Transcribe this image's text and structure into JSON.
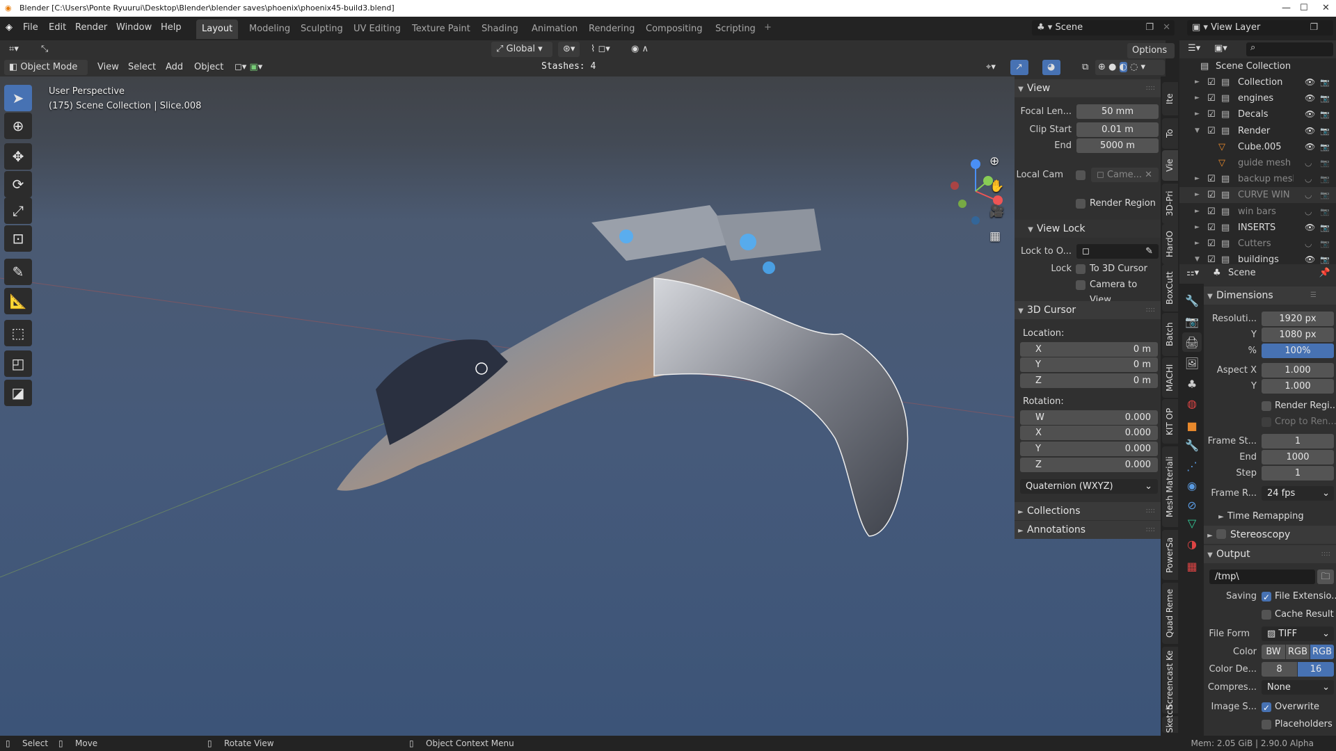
{
  "window": {
    "title": "Blender [C:\\Users\\Ponte Ryuurui\\Desktop\\Blender\\blender saves\\phoenix\\phoenix45-build3.blend]"
  },
  "menu": [
    "File",
    "Edit",
    "Render",
    "Window",
    "Help"
  ],
  "workspaces": [
    {
      "label": "Layout",
      "active": true
    },
    {
      "label": "Modeling"
    },
    {
      "label": "Sculpting"
    },
    {
      "label": "UV Editing"
    },
    {
      "label": "Texture Paint"
    },
    {
      "label": "Shading"
    },
    {
      "label": "Animation"
    },
    {
      "label": "Rendering"
    },
    {
      "label": "Compositing"
    },
    {
      "label": "Scripting"
    }
  ],
  "add_workspace": "+",
  "scene_selector": {
    "value": "Scene"
  },
  "view_layer_selector": {
    "value": "View Layer"
  },
  "tool_settings": {
    "orientation": "Global",
    "options": "Options"
  },
  "viewport_header": {
    "mode": "Object Mode",
    "menus": [
      "View",
      "Select",
      "Add",
      "Object"
    ],
    "stashes": "Stashes: 4"
  },
  "viewport_overlay": {
    "line1": "User Perspective",
    "line2": "(175) Scene Collection | Slice.008"
  },
  "toolbar": [
    "select-box",
    "cursor",
    "move",
    "rotate",
    "scale",
    "transform",
    "annotate",
    "measure",
    "add-cube",
    "extrude-region",
    "bevel"
  ],
  "npanel": {
    "view": {
      "title": "View",
      "focal_label": "Focal Len...",
      "focal": "50 mm",
      "clip_start_label": "Clip Start",
      "clip_start": "0.01 m",
      "end_label": "End",
      "end": "5000 m",
      "local_cam_label": "Local Cam",
      "local_cam": "Came...",
      "render_region": "Render Region"
    },
    "view_lock": {
      "title": "View Lock",
      "lock_to_label": "Lock to O...",
      "lock_label": "Lock",
      "to_cursor": "To 3D Cursor",
      "camera_to_view": "Camera to View"
    },
    "cursor": {
      "title": "3D Cursor",
      "location_label": "Location:",
      "x": "0 m",
      "y": "0 m",
      "z": "0 m",
      "rotation_label": "Rotation:",
      "w": "0.000",
      "rx": "0.000",
      "ry": "0.000",
      "rz": "0.000",
      "mode": "Quaternion (WXYZ)",
      "axis_x": "X",
      "axis_y": "Y",
      "axis_z": "Z",
      "axis_w": "W"
    },
    "collections": "Collections",
    "annotations": "Annotations"
  },
  "vertical_tabs": [
    "Ite",
    "To",
    "Vie",
    "3D-Pri",
    "HardO",
    "BoxCutt",
    "Batch",
    "MACHI",
    "KIT OP",
    "Mesh Materiali",
    "PowerSa",
    "Quad Reme",
    "Screencast Ke",
    "Sketch Sty"
  ],
  "vertical_tab_active": "Vie",
  "outliner": {
    "root": "Scene Collection",
    "items": [
      {
        "name": "Collection",
        "visible": true
      },
      {
        "name": "engines",
        "visible": true
      },
      {
        "name": "Decals",
        "visible": true
      },
      {
        "name": "Render",
        "visible": true
      },
      {
        "name": "Cube.005",
        "visible": true,
        "type": "mesh"
      },
      {
        "name": "guide mesh",
        "visible": false,
        "type": "mesh"
      },
      {
        "name": "backup mesh",
        "visible": false
      },
      {
        "name": "CURVE WIN",
        "visible": false
      },
      {
        "name": "win bars",
        "visible": false
      },
      {
        "name": "INSERTS",
        "visible": true
      },
      {
        "name": "Cutters",
        "visible": false
      },
      {
        "name": "buildings",
        "visible": true
      }
    ]
  },
  "properties": {
    "context": "Scene",
    "dimensions": {
      "title": "Dimensions",
      "res_label": "Resoluti...",
      "res_x": "1920 px",
      "y_label": "Y",
      "res_y": "1080 px",
      "pct_label": "%",
      "pct": "100%",
      "aspect_label": "Aspect X",
      "aspect_x": "1.000",
      "aspect_y": "1.000",
      "render_region": "Render Regi...",
      "crop": "Crop to Ren...",
      "frame_start_label": "Frame St...",
      "frame_start": "1",
      "end_label": "End",
      "frame_end": "1000",
      "step_label": "Step",
      "step": "1",
      "rate_label": "Frame R...",
      "rate": "24 fps",
      "time_remap": "Time Remapping"
    },
    "stereoscopy": "Stereoscopy",
    "output": {
      "title": "Output",
      "path": "/tmp\\",
      "saving_label": "Saving",
      "file_ext": "File Extensio...",
      "cache": "Cache Result",
      "format_label": "File Form",
      "format": "TIFF",
      "color_label": "Color",
      "color_opts": [
        "BW",
        "RGB",
        "RGB"
      ],
      "depth_label": "Color De...",
      "depth_opts": [
        "8",
        "16"
      ],
      "compress_label": "Compres...",
      "compress": "None",
      "image_label": "Image S...",
      "overwrite": "Overwrite",
      "placeholders": "Placeholders"
    }
  },
  "status": {
    "select": "Select",
    "move": "Move",
    "rotate": "Rotate View",
    "context": "Object Context Menu",
    "mem": "Mem: 2.05 GiB | 2.90.0 Alpha"
  },
  "colors": {
    "accent": "#4772b3",
    "panel": "#303030",
    "field": "#545454",
    "topbar": "#232323"
  }
}
